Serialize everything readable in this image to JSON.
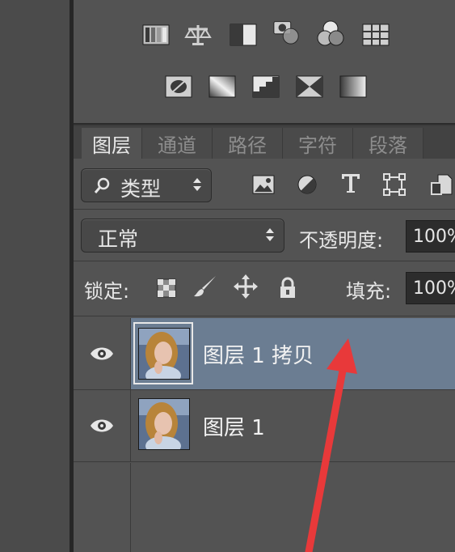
{
  "adjustments": {
    "row1_icons": [
      "levels-icon",
      "balance-icon",
      "exposure-icon",
      "camera-filter-icon",
      "channel-mixer-icon",
      "color-lookup-icon"
    ],
    "row2_icons": [
      "invert-icon",
      "posterize-icon",
      "threshold-icon",
      "selective-color-icon",
      "gradient-map-icon"
    ]
  },
  "tabs": [
    {
      "label": "图层",
      "active": true
    },
    {
      "label": "通道",
      "active": false
    },
    {
      "label": "路径",
      "active": false
    },
    {
      "label": "字符",
      "active": false
    },
    {
      "label": "段落",
      "active": false
    }
  ],
  "filter": {
    "label": "类型",
    "icons": [
      "image-filter-icon",
      "adjustment-filter-icon",
      "type-filter-icon",
      "shape-filter-icon",
      "smart-object-filter-icon"
    ]
  },
  "blend": {
    "mode": "正常",
    "opacity_label": "不透明度:",
    "opacity_value": "100%"
  },
  "lock": {
    "label": "锁定:",
    "fill_label": "填充:",
    "fill_value": "100%"
  },
  "layers": [
    {
      "name": "图层 1 拷贝",
      "selected": true,
      "visible": true
    },
    {
      "name": "图层 1",
      "selected": false,
      "visible": true
    }
  ],
  "colors": {
    "panel": "#535353",
    "selected_row": "#6b7d92",
    "annotation_arrow": "#e8393a"
  }
}
